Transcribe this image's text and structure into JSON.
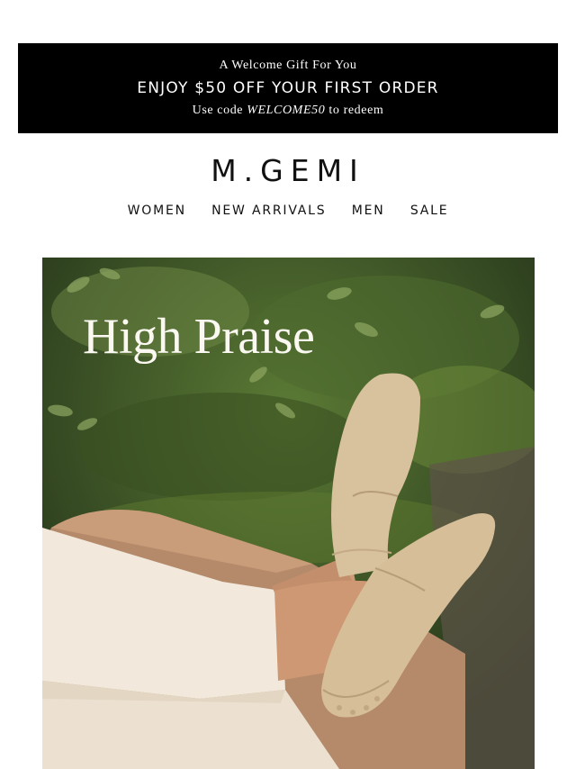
{
  "promo": {
    "kicker": "A Welcome Gift For You",
    "headline": "ENJOY $50 OFF YOUR FIRST ORDER",
    "code_prefix": "Use code",
    "code": "WELCOME50",
    "code_suffix": "to redeem"
  },
  "brand": {
    "logo": "M.GEMI"
  },
  "nav": {
    "items": [
      "WOMEN",
      "NEW ARRIVALS",
      "MEN",
      "SALE"
    ]
  },
  "hero": {
    "title": "High Praise",
    "image": "suede-driving-loafers-photo"
  },
  "colors": {
    "banner_bg": "#000000",
    "banner_text": "#ffffff",
    "loafer": "#d5bd99",
    "trousers": "#f2e9dc"
  }
}
